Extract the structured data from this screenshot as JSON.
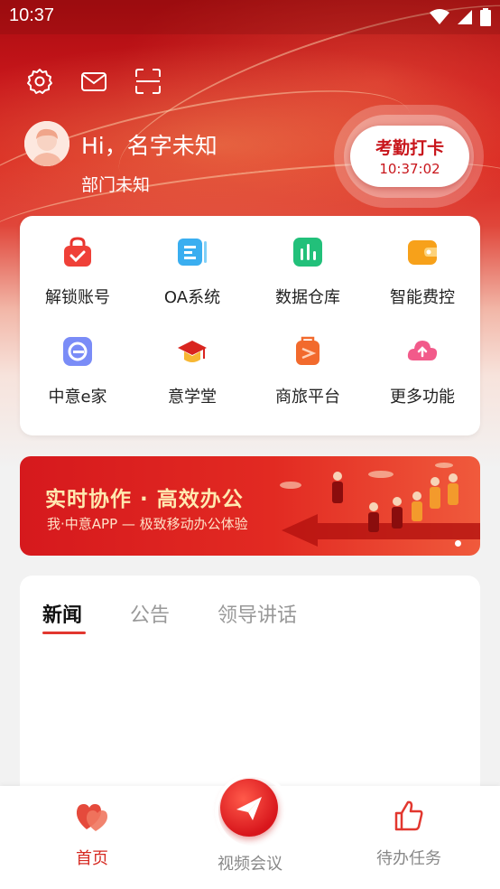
{
  "status_bar": {
    "time": "10:37"
  },
  "header": {
    "icons": [
      "gear-icon",
      "mail-icon",
      "scan-icon"
    ],
    "greeting": "Hi，名字未知",
    "department": "部门未知",
    "checkin": {
      "label": "考勤打卡",
      "time": "10:37:02"
    }
  },
  "apps": [
    {
      "label": "解锁账号",
      "icon": "unlock-bag-icon",
      "color": "#e8342e"
    },
    {
      "label": "OA系统",
      "icon": "oa-system-icon",
      "color": "#3aaef0"
    },
    {
      "label": "数据仓库",
      "icon": "data-warehouse-icon",
      "color": "#22c07a"
    },
    {
      "label": "智能费控",
      "icon": "wallet-icon",
      "color": "#f7a11a"
    },
    {
      "label": "中意e家",
      "icon": "e-home-icon",
      "color": "#6a7cf5"
    },
    {
      "label": "意学堂",
      "icon": "graduation-cap-icon",
      "color": "#e8342e"
    },
    {
      "label": "商旅平台",
      "icon": "luggage-icon",
      "color": "#f26a2d"
    },
    {
      "label": "更多功能",
      "icon": "cloud-upload-icon",
      "color": "#f25a8a"
    }
  ],
  "banner": {
    "title": "实时协作 · 高效办公",
    "subtitle": "我·中意APP — 极致移动办公体验"
  },
  "news": {
    "tabs": [
      "新闻",
      "公告",
      "领导讲话"
    ],
    "active_tab": "新闻"
  },
  "bottom_nav": {
    "home": "首页",
    "video": "视频会议",
    "tasks": "待办任务"
  },
  "colors": {
    "brand_red": "#d8161c",
    "active_tab_underline": "#e2372f"
  }
}
